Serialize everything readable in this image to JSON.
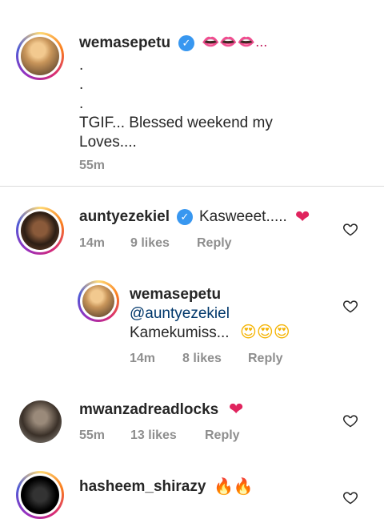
{
  "caption": {
    "username": "wemasepetu",
    "emoji_suffix": "👄👄👄...",
    "body": ".\n.\n.\nTGIF... Blessed weekend my\nLoves....",
    "time": "55m"
  },
  "comments": [
    {
      "username": "auntyezekiel",
      "text": "Kasweeet.....",
      "emoji": "❤",
      "time": "14m",
      "likes": "9 likes",
      "reply_label": "Reply"
    },
    {
      "username": "wemasepetu",
      "mention": "@auntyezekiel",
      "text": "Kamekumiss...",
      "emoji": "😍😍😍",
      "time": "14m",
      "likes": "8 likes",
      "reply_label": "Reply"
    },
    {
      "username": "mwanzadreadlocks",
      "emoji": "❤",
      "time": "55m",
      "likes": "13 likes",
      "reply_label": "Reply"
    },
    {
      "username": "hasheem_shirazy",
      "emoji": "🔥🔥"
    }
  ],
  "icons": {
    "verified": "verified-badge-icon",
    "like": "heart-outline-icon"
  },
  "colors": {
    "verified_blue": "#3897f0",
    "meta_gray": "#8e8e8e",
    "mention_blue": "#00376b",
    "divider": "#dbdbdb"
  }
}
